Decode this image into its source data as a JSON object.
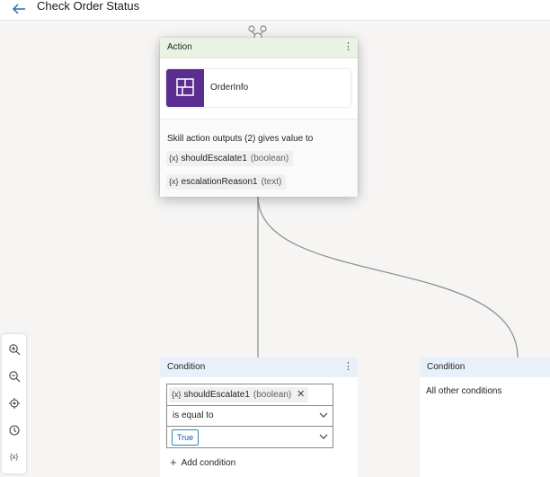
{
  "header": {
    "title": "Check Order Status",
    "back_icon": "arrow-left-icon"
  },
  "action_node": {
    "header": "Action",
    "menu_icon": "more-vertical-icon",
    "skill": {
      "name": "OrderInfo",
      "icon": "table-grid-icon",
      "icon_color": "#5c2d91"
    },
    "outputs_text": "Skill action outputs (2) gives value to",
    "outputs": [
      {
        "icon_text": "{x}",
        "name": "shouldEscalate1",
        "type": "(boolean)"
      },
      {
        "icon_text": "{x}",
        "name": "escalationReason1",
        "type": "(text)"
      }
    ]
  },
  "condition_node": {
    "header": "Condition",
    "menu_icon": "more-vertical-icon",
    "variable": {
      "icon_text": "{x}",
      "name": "shouldEscalate1",
      "type": "(boolean)",
      "remove": "✕"
    },
    "operator": "is equal to",
    "value": "True",
    "add_label": "Add condition"
  },
  "other_condition_node": {
    "header": "Condition",
    "text": "All other conditions"
  },
  "toolbar": {
    "tools": [
      "zoom-in-icon",
      "zoom-out-icon",
      "recenter-icon",
      "history-icon",
      "variables-icon"
    ],
    "variables_label": "{x}"
  },
  "colors": {
    "action_header": "#e8f3e3",
    "condition_header": "#e8f0f9",
    "canvas": "#f6f5f4",
    "accent": "#2b88b8"
  }
}
